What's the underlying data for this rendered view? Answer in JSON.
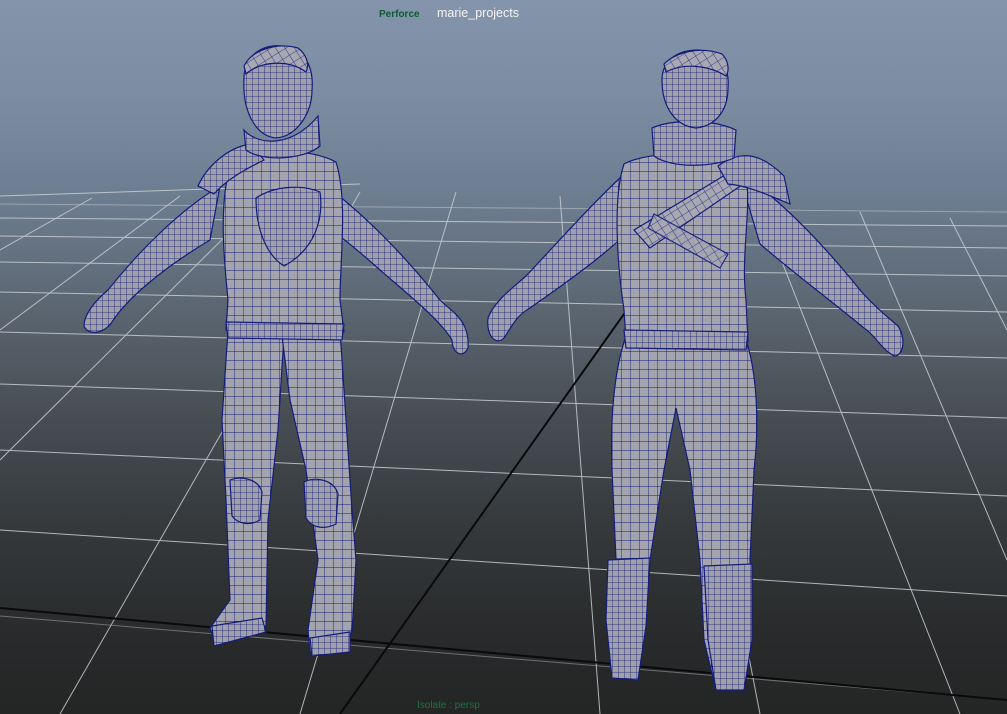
{
  "hud": {
    "vcs_label": "Perforce",
    "project_name": "marie_projects",
    "isolate_label": "Isolate : persp"
  },
  "colors": {
    "wire": "#141c7a",
    "mesh_fill": "#a3a4ae",
    "mesh_shade": "#8b8c96",
    "grid": "#c9ced4",
    "axis": "#0a0a0a",
    "perforce_text": "#0d5a32",
    "isolate_text": "#16763f"
  },
  "viewport": {
    "camera": "persp",
    "display_mode": "wireframe-on-shaded"
  }
}
